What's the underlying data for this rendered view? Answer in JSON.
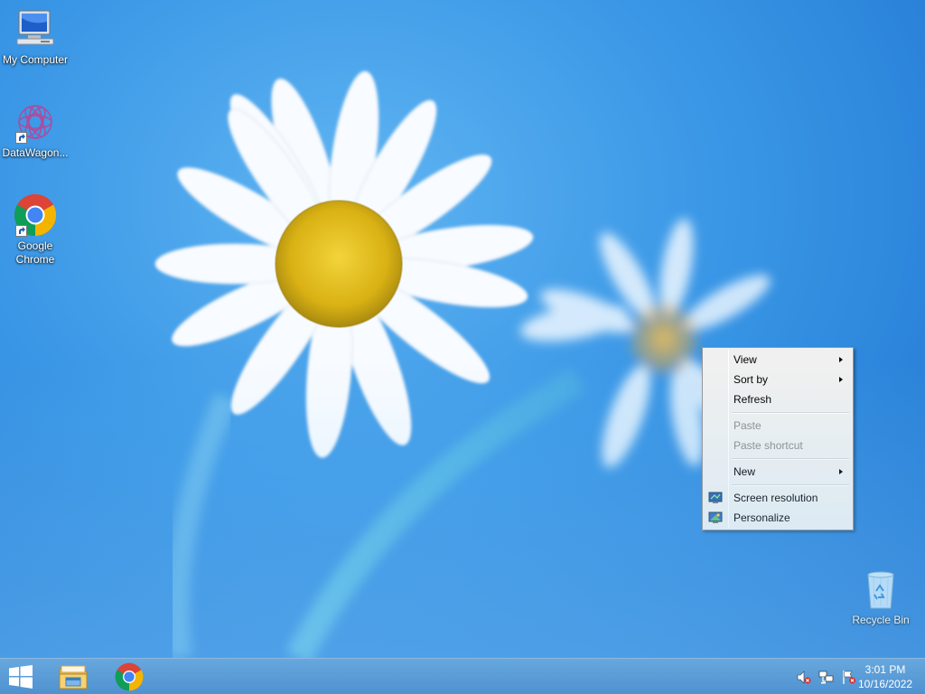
{
  "desktop": {
    "icons": [
      {
        "label": "My Computer",
        "icon": "computer-icon"
      },
      {
        "label": "DataWagon...",
        "icon": "datawagon-icon"
      },
      {
        "label": "Google Chrome",
        "icon": "chrome-icon"
      },
      {
        "label": "Recycle Bin",
        "icon": "recycle-bin-icon"
      }
    ]
  },
  "context_menu": {
    "items": [
      {
        "label": "View",
        "submenu": true,
        "enabled": true
      },
      {
        "label": "Sort by",
        "submenu": true,
        "enabled": true
      },
      {
        "label": "Refresh",
        "enabled": true
      },
      {
        "label": "Paste",
        "enabled": false
      },
      {
        "label": "Paste shortcut",
        "enabled": false
      },
      {
        "label": "New",
        "submenu": true,
        "enabled": true
      },
      {
        "label": "Screen resolution",
        "icon": "screen-resolution-icon",
        "enabled": true
      },
      {
        "label": "Personalize",
        "icon": "personalize-icon",
        "enabled": true
      }
    ]
  },
  "taskbar": {
    "start": {
      "icon": "windows-logo-icon"
    },
    "pinned": [
      {
        "name": "File Explorer",
        "icon": "file-explorer-icon"
      },
      {
        "name": "Google Chrome",
        "icon": "chrome-icon"
      }
    ],
    "tray": [
      {
        "icon": "volume-muted-icon"
      },
      {
        "icon": "network-icon"
      },
      {
        "icon": "action-center-flag-icon"
      }
    ],
    "clock": {
      "time": "3:01 PM",
      "date": "10/16/2022"
    }
  },
  "colors": {
    "wallpaper_blue": "#3a97e6",
    "taskbar": "#5a9fdb",
    "menu_bg": "#f0f0f0",
    "disabled_text": "#8d8d8d"
  }
}
